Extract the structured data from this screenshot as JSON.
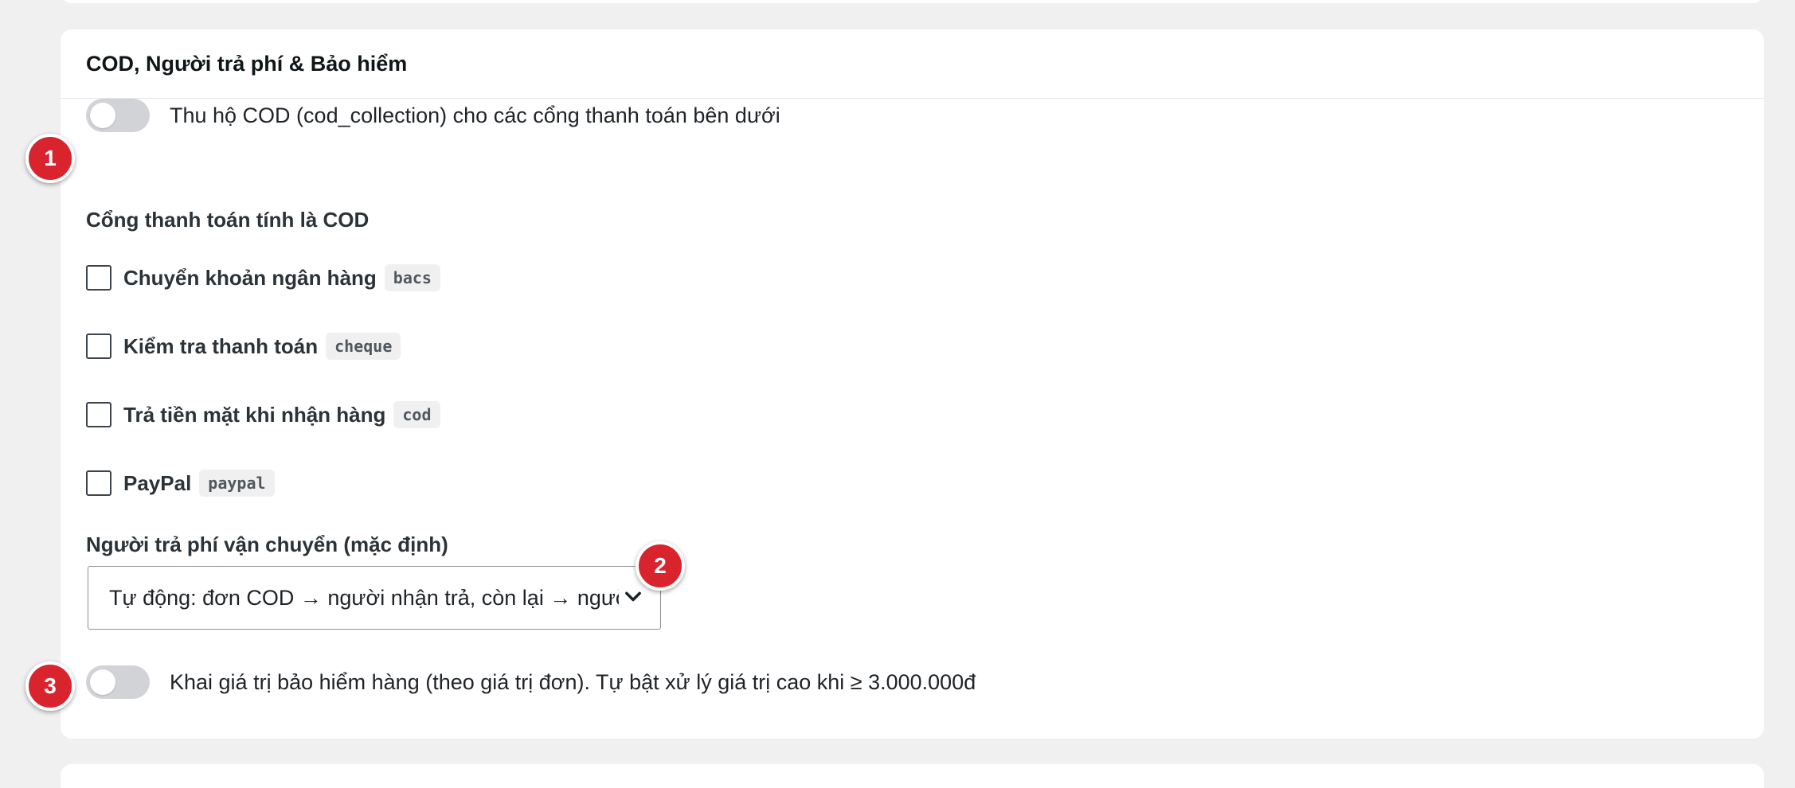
{
  "section": {
    "title": "COD, Người trả phí & Bảo hiểm"
  },
  "cod_toggle": {
    "label": "Thu hộ COD (cod_collection) cho các cổng thanh toán bên dưới",
    "enabled": false
  },
  "gateways": {
    "label": "Cổng thanh toán tính là COD",
    "items": [
      {
        "label": "Chuyển khoản ngân hàng",
        "code": "bacs",
        "checked": false
      },
      {
        "label": "Kiểm tra thanh toán",
        "code": "cheque",
        "checked": false
      },
      {
        "label": "Trả tiền mặt khi nhận hàng",
        "code": "cod",
        "checked": false
      },
      {
        "label": "PayPal",
        "code": "paypal",
        "checked": false
      }
    ]
  },
  "payer": {
    "label": "Người trả phí vận chuyển (mặc định)",
    "selected": "Tự động: đơn COD → người nhận trả, còn lại → người gửi trả"
  },
  "insurance_toggle": {
    "label": "Khai giá trị bảo hiểm hàng (theo giá trị đơn). Tự bật xử lý giá trị cao khi ≥ 3.000.000đ",
    "enabled": false
  },
  "badges": [
    "1",
    "2",
    "3"
  ],
  "colors": {
    "badge": "#d9232d",
    "toggle_off": "#d1d3d6",
    "page_bg": "#f0f0f1"
  },
  "icons": {
    "select_arrow": "chevron-down-icon"
  }
}
